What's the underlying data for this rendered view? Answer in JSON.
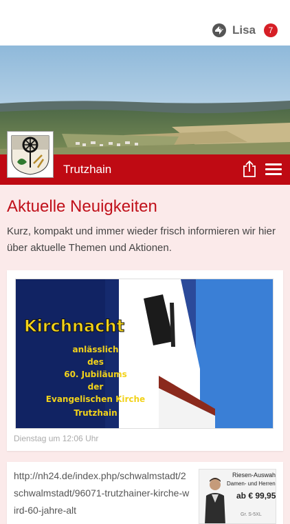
{
  "user": {
    "name": "Lisa",
    "notification_count": "7",
    "logo_icon": "app-logo-icon"
  },
  "header": {
    "town": "Trutzhain",
    "share_icon": "share-icon",
    "menu_icon": "hamburger-menu-icon"
  },
  "news": {
    "title": "Aktuelle Neuigkeiten",
    "intro": "Kurz, kompakt und immer wieder frisch informieren wir hier über aktuelle Themen und Aktionen."
  },
  "posts": [
    {
      "image": {
        "headline": "Kirchnacht",
        "lines": [
          "anlässlich",
          "des",
          "60. Jubiläums",
          "der",
          "Evangelischen Kirche",
          "Trutzhain"
        ]
      },
      "date": "Dienstag um 12:06 Uhr"
    },
    {
      "link": "http://nh24.de/index.php/schwalmstadt/2 schwalmstadt/96071-trutzhainer-kirche-wird-60-jahre-alt",
      "ad": {
        "line1": "Riesen-Auswah",
        "line2": "Damen- und Herren-",
        "price": "ab € 99,95",
        "size": "Gr. S-5XL"
      }
    }
  ],
  "colors": {
    "brand_red": "#bf0a13",
    "title_red": "#c0101a",
    "background": "#fbeaea"
  }
}
